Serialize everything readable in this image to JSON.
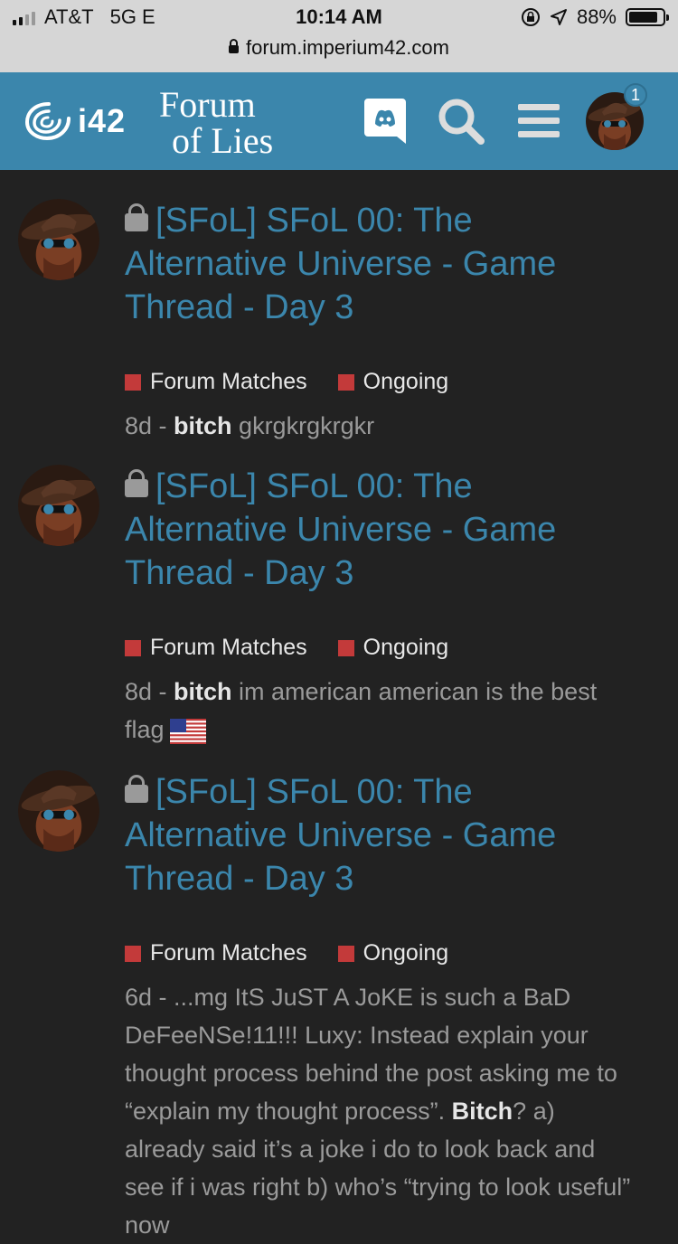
{
  "status_bar": {
    "carrier": "AT&T",
    "network": "5G E",
    "time": "10:14 AM",
    "battery": "88%",
    "battery_level": 0.88
  },
  "browser": {
    "url": "forum.imperium42.com"
  },
  "header": {
    "logo_text": "i42",
    "brand_line1": "Forum",
    "brand_line2": "of Lies",
    "notification_count": "1",
    "accent_color": "#3b86ac"
  },
  "topics": [
    {
      "title": "[SFoL] SFoL 00: The Alternative Universe - Game Thread - Day 3",
      "tags": [
        "Forum Matches",
        "Ongoing"
      ],
      "age": "8d",
      "sep": " - ",
      "author": "bitch",
      "excerpt": " gkrgkrgkrgkr"
    },
    {
      "title": "[SFoL] SFoL 00: The Alternative Universe - Game Thread - Day 3",
      "tags": [
        "Forum Matches",
        "Ongoing"
      ],
      "age": "8d",
      "sep": " - ",
      "author": "bitch",
      "excerpt": " im american american is the best flag"
    },
    {
      "title": "[SFoL] SFoL 00: The Alternative Universe - Game Thread - Day 3",
      "tags": [
        "Forum Matches",
        "Ongoing"
      ],
      "age": "6d",
      "sep": " - ",
      "excerpt_start": "...mg ItS JuST A JoKE is such a BaD DeFeeNSe!11!!! Luxy: Instead explain your thought process behind the post asking me to “explain my thought process”. ",
      "excerpt_bold": "Bitch",
      "excerpt_end": "? a) already said it’s a joke i do to look back and see if i was right b) who’s “trying to look useful” now"
    }
  ]
}
